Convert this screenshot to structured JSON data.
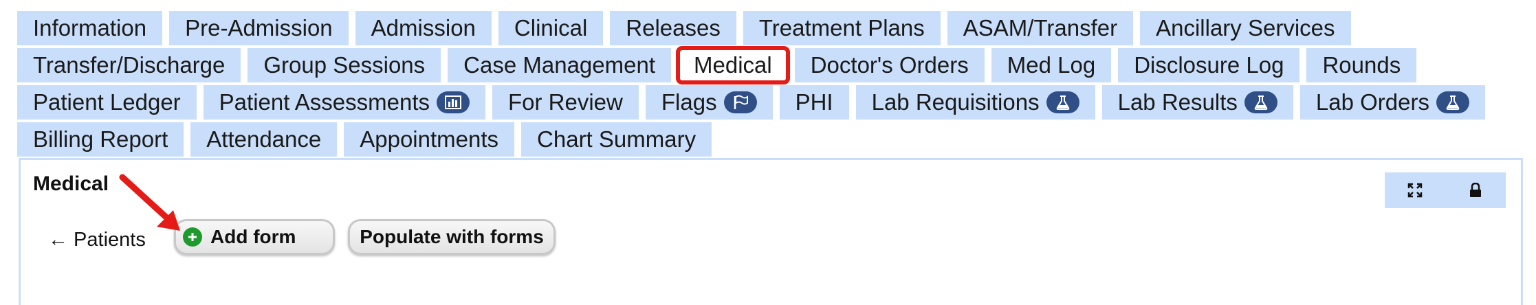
{
  "tab_rows": [
    [
      {
        "label": "Information",
        "name": "tab-information"
      },
      {
        "label": "Pre-Admission",
        "name": "tab-pre-admission"
      },
      {
        "label": "Admission",
        "name": "tab-admission"
      },
      {
        "label": "Clinical",
        "name": "tab-clinical"
      },
      {
        "label": "Releases",
        "name": "tab-releases"
      },
      {
        "label": "Treatment Plans",
        "name": "tab-treatment-plans"
      },
      {
        "label": "ASAM/Transfer",
        "name": "tab-asam-transfer"
      },
      {
        "label": "Ancillary Services",
        "name": "tab-ancillary-services"
      }
    ],
    [
      {
        "label": "Transfer/Discharge",
        "name": "tab-transfer-discharge"
      },
      {
        "label": "Group Sessions",
        "name": "tab-group-sessions"
      },
      {
        "label": "Case Management",
        "name": "tab-case-management"
      },
      {
        "label": "Medical",
        "name": "tab-medical",
        "active": true
      },
      {
        "label": "Doctor's Orders",
        "name": "tab-doctors-orders"
      },
      {
        "label": "Med Log",
        "name": "tab-med-log"
      },
      {
        "label": "Disclosure Log",
        "name": "tab-disclosure-log"
      },
      {
        "label": "Rounds",
        "name": "tab-rounds"
      }
    ],
    [
      {
        "label": "Patient Ledger",
        "name": "tab-patient-ledger"
      },
      {
        "label": "Patient Assessments",
        "name": "tab-patient-assessments",
        "icon": "bar-chart-icon"
      },
      {
        "label": "For Review",
        "name": "tab-for-review"
      },
      {
        "label": "Flags",
        "name": "tab-flags",
        "icon": "flag-icon"
      },
      {
        "label": "PHI",
        "name": "tab-phi"
      },
      {
        "label": "Lab Requisitions",
        "name": "tab-lab-requisitions",
        "icon": "flask-icon"
      },
      {
        "label": "Lab Results",
        "name": "tab-lab-results",
        "icon": "flask-icon"
      },
      {
        "label": "Lab Orders",
        "name": "tab-lab-orders",
        "icon": "flask-icon"
      }
    ],
    [
      {
        "label": "Billing Report",
        "name": "tab-billing-report"
      },
      {
        "label": "Attendance",
        "name": "tab-attendance"
      },
      {
        "label": "Appointments",
        "name": "tab-appointments"
      },
      {
        "label": "Chart Summary",
        "name": "tab-chart-summary"
      }
    ]
  ],
  "panel": {
    "title": "Medical",
    "back_link": "← Patients",
    "add_form_label": "Add form",
    "populate_label": "Populate with forms",
    "tools": [
      "expand-icon",
      "lock-icon"
    ]
  },
  "colors": {
    "tab_bg": "#c9defa",
    "active_outline": "#e41b17",
    "badge_bg": "#2f4f86",
    "add_icon": "#1f9a2e",
    "annotation_arrow": "#e41b17"
  }
}
